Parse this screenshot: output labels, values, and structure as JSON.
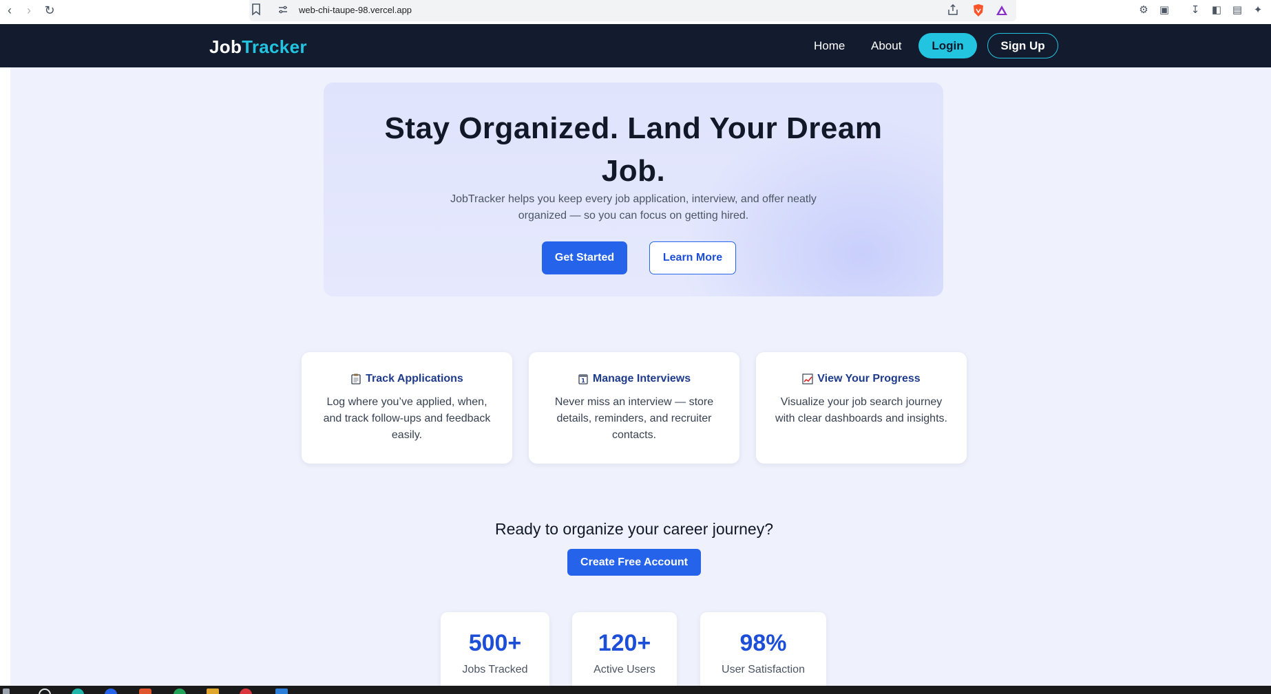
{
  "browser": {
    "url": "web-chi-taupe-98.vercel.app"
  },
  "nav": {
    "logo_part1": "Job",
    "logo_part2": "Tracker",
    "links": [
      "Home",
      "About"
    ],
    "login_label": "Login",
    "signup_label": "Sign Up"
  },
  "hero": {
    "title": "Stay Organized. Land Your Dream Job.",
    "subtitle": "JobTracker helps you keep every job application, interview, and offer neatly organized — so you can focus on getting hired.",
    "primary_label": "Get Started",
    "secondary_label": "Learn More"
  },
  "features": [
    {
      "icon": "clipboard-icon",
      "title": "Track Applications",
      "description": "Log where you’ve applied, when, and track follow-ups and feedback easily."
    },
    {
      "icon": "calendar-icon",
      "title": "Manage Interviews",
      "description": "Never miss an interview — store details, reminders, and recruiter contacts."
    },
    {
      "icon": "chart-up-icon",
      "title": "View Your Progress",
      "description": "Visualize your job search journey with clear dashboards and insights."
    }
  ],
  "cta": {
    "text": "Ready to organize your career journey?",
    "button_label": "Create Free Account"
  },
  "stats": [
    {
      "value": "500+",
      "label": "Jobs Tracked"
    },
    {
      "value": "120+",
      "label": "Active Users"
    },
    {
      "value": "98%",
      "label": "User Satisfaction"
    }
  ],
  "colors": {
    "nav_bg": "#131c2e",
    "accent_cyan": "#22c4e0",
    "primary_blue": "#2563eb",
    "page_bg": "#eff1fc"
  }
}
